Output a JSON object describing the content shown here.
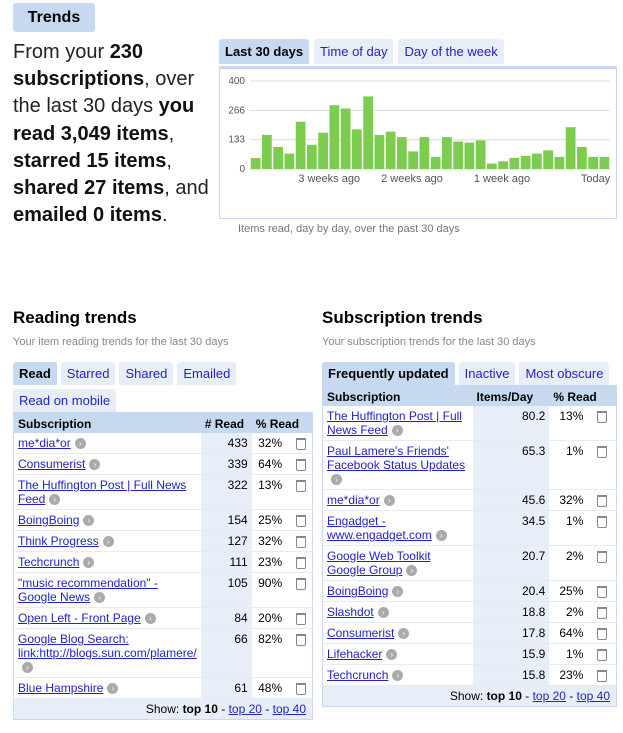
{
  "page_title": "Trends",
  "summary": {
    "p1": "From your ",
    "subs": "230 subscriptions",
    "p2": ", over the last 30 days ",
    "read": "you read 3,049 items",
    "p3": ", ",
    "starred": "starred 15 items",
    "p4": ", ",
    "shared": "shared 27 items",
    "p5": ", and ",
    "emailed": "emailed 0 items",
    "p6": "."
  },
  "chart_tabs": [
    "Last 30 days",
    "Time of day",
    "Day of the week"
  ],
  "chart_caption": "Items read, day by day, over the past 30 days",
  "chart_data": {
    "type": "bar",
    "title": "",
    "y_ticks": [
      "400",
      "266",
      "133",
      "0"
    ],
    "ylim": [
      0,
      400
    ],
    "x_labels": [
      "3 weeks ago",
      "2 weeks ago",
      "1 week ago",
      "Today"
    ],
    "values": [
      50,
      155,
      100,
      70,
      215,
      110,
      165,
      290,
      275,
      180,
      330,
      155,
      170,
      145,
      80,
      145,
      55,
      145,
      125,
      120,
      130,
      25,
      35,
      50,
      60,
      70,
      85,
      55,
      190,
      100,
      55,
      55
    ]
  },
  "reading": {
    "title": "Reading trends",
    "subtitle": "Your item reading trends for the last 30 days",
    "tabs": [
      "Read",
      "Starred",
      "Shared",
      "Emailed",
      "Read on mobile"
    ],
    "columns": [
      "Subscription",
      "# Read",
      "% Read"
    ],
    "rows": [
      {
        "name": "me*dia*or",
        "count": "433",
        "pct": "32%"
      },
      {
        "name": "Consumerist",
        "count": "339",
        "pct": "64%"
      },
      {
        "name": "The Huffington Post | Full News Feed",
        "count": "322",
        "pct": "13%"
      },
      {
        "name": "BoingBoing",
        "count": "154",
        "pct": "25%"
      },
      {
        "name": "Think Progress",
        "count": "127",
        "pct": "32%"
      },
      {
        "name": "Techcrunch",
        "count": "111",
        "pct": "23%"
      },
      {
        "name": "\"music recommendation\" - Google News",
        "count": "105",
        "pct": "90%"
      },
      {
        "name": "Open Left - Front Page",
        "count": "84",
        "pct": "20%"
      },
      {
        "name": "Google Blog Search: link:http://blogs.sun.com/plamere/",
        "count": "66",
        "pct": "82%"
      },
      {
        "name": "Blue Hampshire",
        "count": "61",
        "pct": "48%"
      }
    ],
    "show_label": "Show:",
    "show_current": "top 10",
    "show_links": [
      "top 20",
      "top 40"
    ]
  },
  "subscription": {
    "title": "Subscription trends",
    "subtitle": "Your subscription trends for the last 30 days",
    "tabs": [
      "Frequently updated",
      "Inactive",
      "Most obscure"
    ],
    "columns": [
      "Subscription",
      "Items/Day",
      "% Read"
    ],
    "rows": [
      {
        "name": "The Huffington Post | Full News Feed",
        "count": "80.2",
        "pct": "13%"
      },
      {
        "name": "Paul Lamere's Friends' Facebook Status Updates",
        "count": "65.3",
        "pct": "1%"
      },
      {
        "name": "me*dia*or",
        "count": "45.6",
        "pct": "32%"
      },
      {
        "name": "Engadget - www.engadget.com",
        "count": "34.5",
        "pct": "1%"
      },
      {
        "name": "Google Web Toolkit Google Group",
        "count": "20.7",
        "pct": "2%"
      },
      {
        "name": "BoingBoing",
        "count": "20.4",
        "pct": "25%"
      },
      {
        "name": "Slashdot",
        "count": "18.8",
        "pct": "2%"
      },
      {
        "name": "Consumerist",
        "count": "17.8",
        "pct": "64%"
      },
      {
        "name": "Lifehacker",
        "count": "15.9",
        "pct": "1%"
      },
      {
        "name": "Techcrunch",
        "count": "15.8",
        "pct": "23%"
      }
    ],
    "show_label": "Show:",
    "show_current": "top 10",
    "show_links": [
      "top 20",
      "top 40"
    ]
  }
}
